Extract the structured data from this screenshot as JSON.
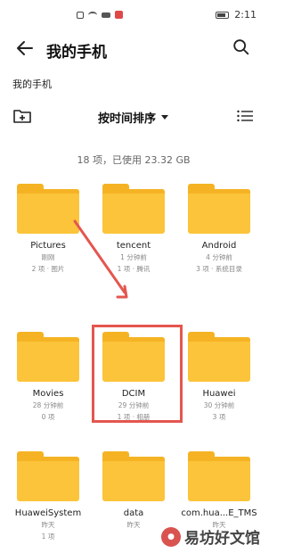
{
  "status": {
    "time": "2:11"
  },
  "header": {
    "title": "我的手机"
  },
  "breadcrumb": "我的手机",
  "toolbar": {
    "sort_label": "按时间排序"
  },
  "summary": "18 项，已使用 23.32 GB",
  "folders": [
    {
      "name": "Pictures",
      "line1": "刚刚",
      "line2": "2 项 · 图片"
    },
    {
      "name": "tencent",
      "line1": "1 分钟前",
      "line2": "1 项 · 腾讯"
    },
    {
      "name": "Android",
      "line1": "4 分钟前",
      "line2": "3 项 · 系统目录"
    },
    {
      "name": "Movies",
      "line1": "28 分钟前",
      "line2": "0 项"
    },
    {
      "name": "DCIM",
      "line1": "29 分钟前",
      "line2": "1 项 · 相册"
    },
    {
      "name": "Huawei",
      "line1": "30 分钟前",
      "line2": "3 项"
    },
    {
      "name": "HuaweiSystem",
      "line1": "昨天",
      "line2": "1 项"
    },
    {
      "name": "data",
      "line1": "昨天",
      "line2": ""
    },
    {
      "name": "com.hua...E_TMS",
      "line1": "昨天",
      "line2": ""
    }
  ],
  "colors": {
    "folder": "#fcc43a",
    "highlight": "#e4564f"
  },
  "watermark": {
    "text": "易坊好文馆"
  }
}
